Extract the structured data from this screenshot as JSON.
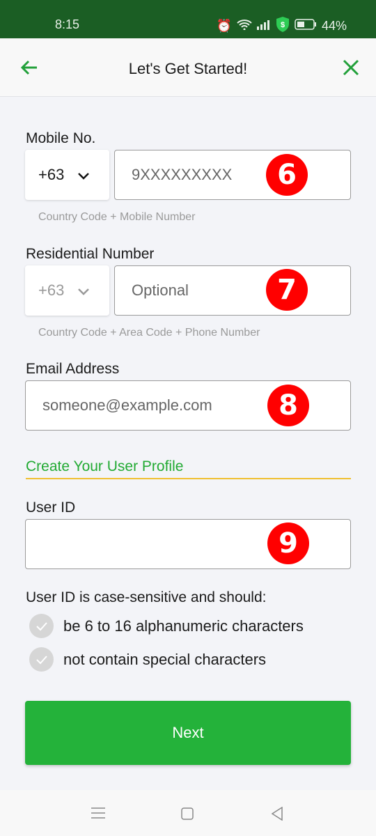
{
  "status_bar": {
    "time": "8:15",
    "battery": "44%",
    "icons": [
      "alarm-icon",
      "wifi-icon",
      "signal-icon",
      "shield-dollar-icon",
      "battery-icon"
    ]
  },
  "header": {
    "title": "Let's Get Started!",
    "back_icon": "arrow-left-icon",
    "close_icon": "close-icon"
  },
  "mobile": {
    "label": "Mobile No.",
    "country_code": "+63",
    "placeholder": "9XXXXXXXXX",
    "hint": "Country Code + Mobile Number",
    "badge": "6"
  },
  "residential": {
    "label": "Residential Number",
    "country_code": "+63",
    "placeholder": "Optional",
    "hint": "Country Code + Area Code + Phone Number",
    "badge": "7"
  },
  "email": {
    "label": "Email Address",
    "placeholder": "someone@example.com",
    "badge": "8"
  },
  "profile": {
    "section_title": "Create Your User Profile",
    "user_id_label": "User ID",
    "user_id_value": "",
    "badge": "9",
    "rules_intro": "User ID is case-sensitive and should:",
    "rules": [
      "be 6 to 16 alphanumeric characters",
      "not contain special characters"
    ]
  },
  "next_label": "Next",
  "colors": {
    "status_bar": "#1b5e24",
    "accent": "#24b23a",
    "badge": "#ff0000",
    "divider": "#f0c030"
  }
}
